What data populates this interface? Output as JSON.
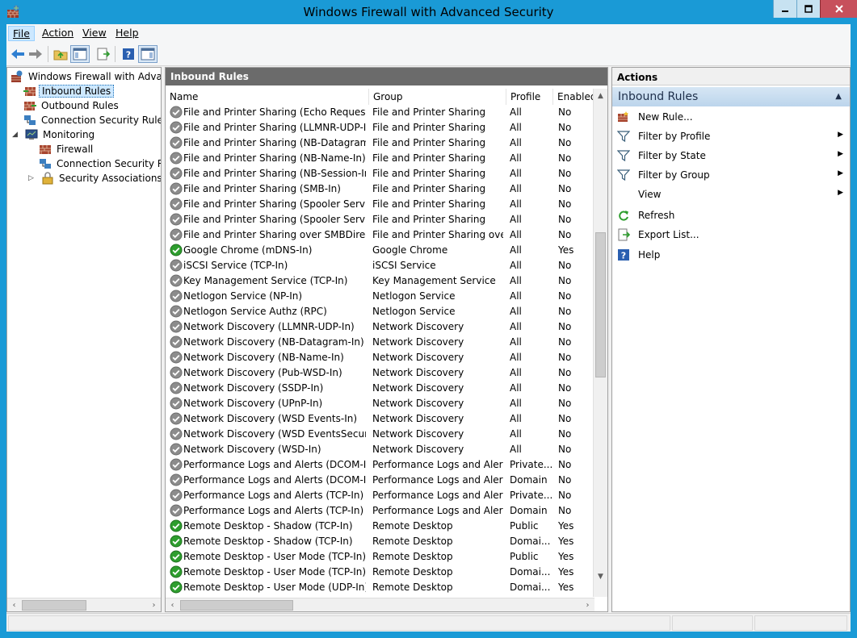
{
  "window": {
    "title": "Windows Firewall with Advanced Security"
  },
  "menu": {
    "file": "File",
    "action": "Action",
    "view": "View",
    "help": "Help"
  },
  "tree": {
    "root": "Windows Firewall with Advanced Security",
    "inbound": "Inbound Rules",
    "outbound": "Outbound Rules",
    "connection": "Connection Security Rules",
    "monitoring": "Monitoring",
    "firewall": "Firewall",
    "mon_connection": "Connection Security Rules",
    "security_assoc": "Security Associations"
  },
  "middle": {
    "header": "Inbound Rules",
    "columns": {
      "name": "Name",
      "group": "Group",
      "profile": "Profile",
      "enabled": "Enabled"
    },
    "rows": [
      {
        "name": "File and Printer Sharing (Echo Request - I...",
        "group": "File and Printer Sharing",
        "profile": "All",
        "enabled": "No"
      },
      {
        "name": "File and Printer Sharing (LLMNR-UDP-In)",
        "group": "File and Printer Sharing",
        "profile": "All",
        "enabled": "No"
      },
      {
        "name": "File and Printer Sharing (NB-Datagram-In)",
        "group": "File and Printer Sharing",
        "profile": "All",
        "enabled": "No"
      },
      {
        "name": "File and Printer Sharing (NB-Name-In)",
        "group": "File and Printer Sharing",
        "profile": "All",
        "enabled": "No"
      },
      {
        "name": "File and Printer Sharing (NB-Session-In)",
        "group": "File and Printer Sharing",
        "profile": "All",
        "enabled": "No"
      },
      {
        "name": "File and Printer Sharing (SMB-In)",
        "group": "File and Printer Sharing",
        "profile": "All",
        "enabled": "No"
      },
      {
        "name": "File and Printer Sharing (Spooler Service -...",
        "group": "File and Printer Sharing",
        "profile": "All",
        "enabled": "No"
      },
      {
        "name": "File and Printer Sharing (Spooler Service -...",
        "group": "File and Printer Sharing",
        "profile": "All",
        "enabled": "No"
      },
      {
        "name": "File and Printer Sharing over SMBDirect (i...",
        "group": "File and Printer Sharing over...",
        "profile": "All",
        "enabled": "No"
      },
      {
        "name": "Google Chrome (mDNS-In)",
        "group": "Google Chrome",
        "profile": "All",
        "enabled": "Yes"
      },
      {
        "name": "iSCSI Service (TCP-In)",
        "group": "iSCSI Service",
        "profile": "All",
        "enabled": "No"
      },
      {
        "name": "Key Management Service (TCP-In)",
        "group": "Key Management Service",
        "profile": "All",
        "enabled": "No"
      },
      {
        "name": "Netlogon Service (NP-In)",
        "group": "Netlogon Service",
        "profile": "All",
        "enabled": "No"
      },
      {
        "name": "Netlogon Service Authz (RPC)",
        "group": "Netlogon Service",
        "profile": "All",
        "enabled": "No"
      },
      {
        "name": "Network Discovery (LLMNR-UDP-In)",
        "group": "Network Discovery",
        "profile": "All",
        "enabled": "No"
      },
      {
        "name": "Network Discovery (NB-Datagram-In)",
        "group": "Network Discovery",
        "profile": "All",
        "enabled": "No"
      },
      {
        "name": "Network Discovery (NB-Name-In)",
        "group": "Network Discovery",
        "profile": "All",
        "enabled": "No"
      },
      {
        "name": "Network Discovery (Pub-WSD-In)",
        "group": "Network Discovery",
        "profile": "All",
        "enabled": "No"
      },
      {
        "name": "Network Discovery (SSDP-In)",
        "group": "Network Discovery",
        "profile": "All",
        "enabled": "No"
      },
      {
        "name": "Network Discovery (UPnP-In)",
        "group": "Network Discovery",
        "profile": "All",
        "enabled": "No"
      },
      {
        "name": "Network Discovery (WSD Events-In)",
        "group": "Network Discovery",
        "profile": "All",
        "enabled": "No"
      },
      {
        "name": "Network Discovery (WSD EventsSecure-In)",
        "group": "Network Discovery",
        "profile": "All",
        "enabled": "No"
      },
      {
        "name": "Network Discovery (WSD-In)",
        "group": "Network Discovery",
        "profile": "All",
        "enabled": "No"
      },
      {
        "name": "Performance Logs and Alerts (DCOM-In)",
        "group": "Performance Logs and Alerts",
        "profile": "Private...",
        "enabled": "No"
      },
      {
        "name": "Performance Logs and Alerts (DCOM-In)",
        "group": "Performance Logs and Alerts",
        "profile": "Domain",
        "enabled": "No"
      },
      {
        "name": "Performance Logs and Alerts (TCP-In)",
        "group": "Performance Logs and Alerts",
        "profile": "Private...",
        "enabled": "No"
      },
      {
        "name": "Performance Logs and Alerts (TCP-In)",
        "group": "Performance Logs and Alerts",
        "profile": "Domain",
        "enabled": "No"
      },
      {
        "name": "Remote Desktop - Shadow (TCP-In)",
        "group": "Remote Desktop",
        "profile": "Public",
        "enabled": "Yes"
      },
      {
        "name": "Remote Desktop - Shadow (TCP-In)",
        "group": "Remote Desktop",
        "profile": "Domai...",
        "enabled": "Yes"
      },
      {
        "name": "Remote Desktop - User Mode (TCP-In)",
        "group": "Remote Desktop",
        "profile": "Public",
        "enabled": "Yes"
      },
      {
        "name": "Remote Desktop - User Mode (TCP-In)",
        "group": "Remote Desktop",
        "profile": "Domai...",
        "enabled": "Yes"
      },
      {
        "name": "Remote Desktop - User Mode (UDP-In)",
        "group": "Remote Desktop",
        "profile": "Domai...",
        "enabled": "Yes"
      }
    ]
  },
  "actions": {
    "title": "Actions",
    "section": "Inbound Rules",
    "items": [
      {
        "label": "New Rule...",
        "icon": "new-rule-icon"
      },
      {
        "label": "Filter by Profile",
        "icon": "filter-icon",
        "submenu": true
      },
      {
        "label": "Filter by State",
        "icon": "filter-icon",
        "submenu": true
      },
      {
        "label": "Filter by Group",
        "icon": "filter-icon",
        "submenu": true
      },
      {
        "label": "View",
        "icon": "",
        "submenu": true
      },
      {
        "label": "Refresh",
        "icon": "refresh-icon"
      },
      {
        "label": "Export List...",
        "icon": "export-icon"
      },
      {
        "label": "Help",
        "icon": "help-icon"
      }
    ]
  },
  "colors": {
    "title_bg": "#1a9ad6",
    "pane_header": "#6b6b6b",
    "enabled_green": "#2e9e2e",
    "disabled_gray": "#8c8c8c",
    "close_red": "#c7505c"
  }
}
